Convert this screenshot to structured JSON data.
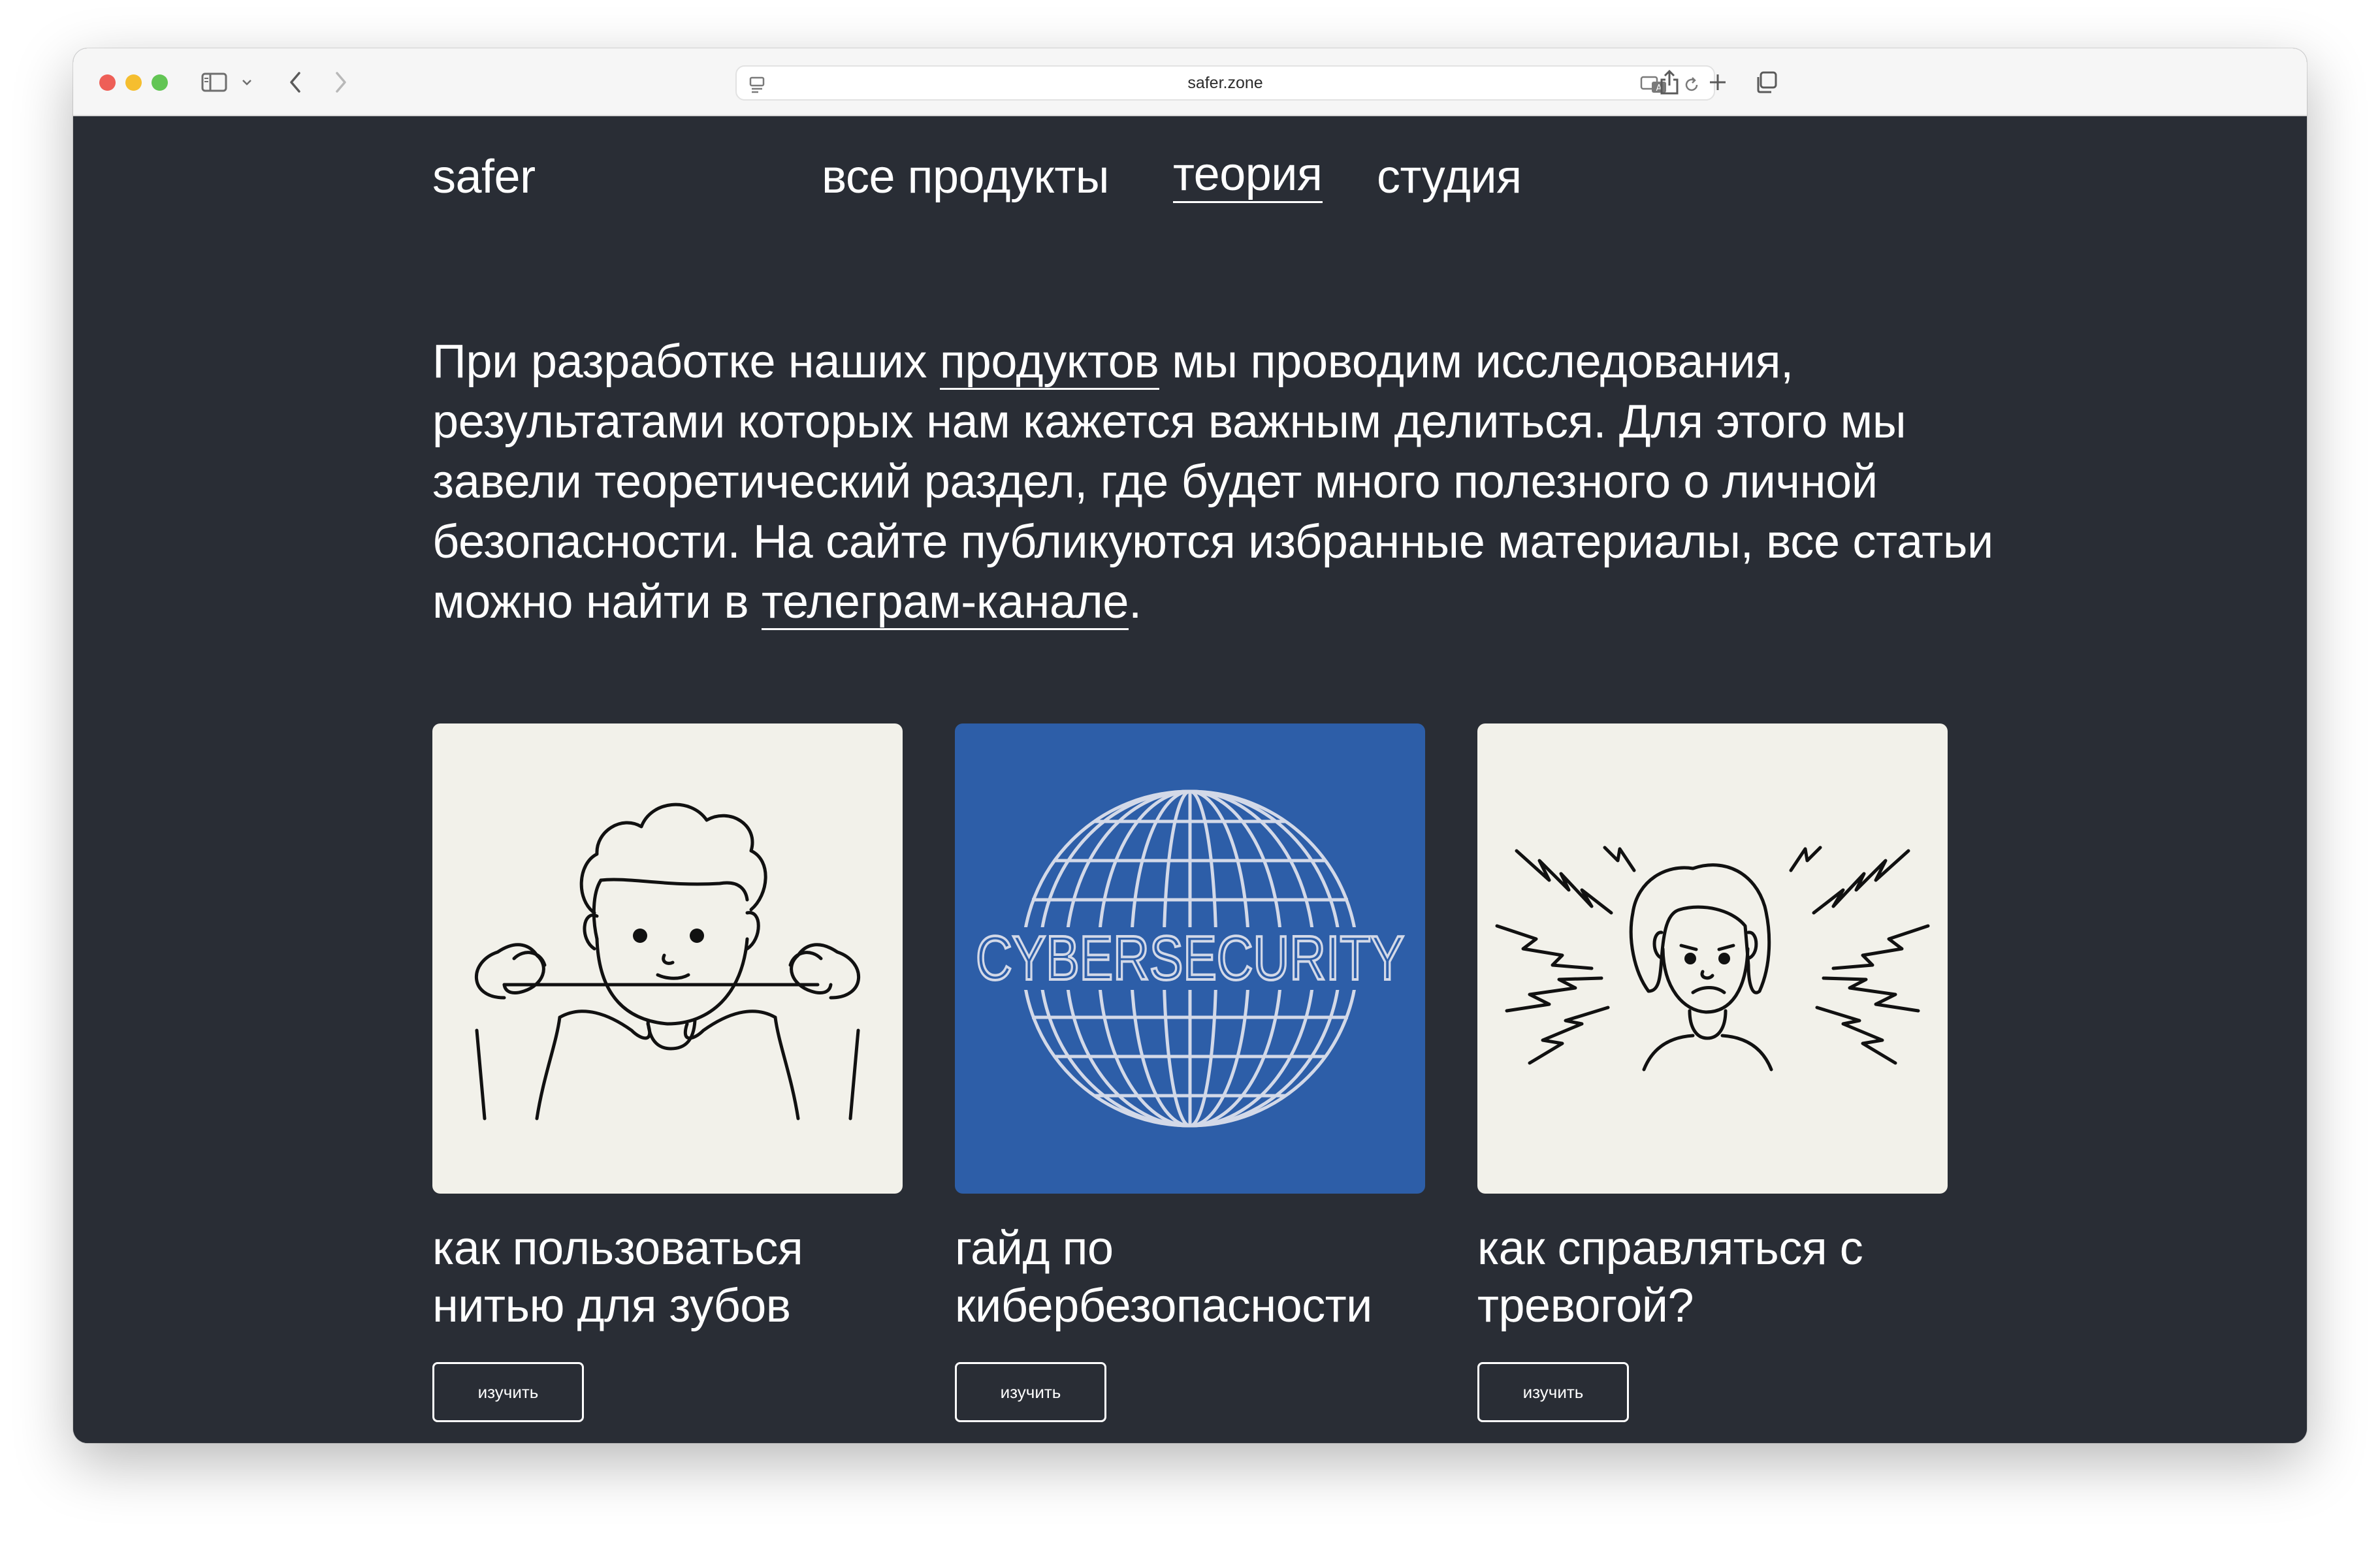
{
  "browser": {
    "url": "safer.zone"
  },
  "site": {
    "logo": "safer",
    "nav": [
      {
        "label": "все продукты",
        "active": false
      },
      {
        "label": "теория",
        "active": true
      },
      {
        "label": "студия",
        "active": false
      }
    ]
  },
  "intro": {
    "part1": "При разработке наших ",
    "link1": "продуктов",
    "part2": " мы проводим исследования, результатами которых нам кажется важным делиться. Для этого мы завели теоретический раздел, где будет много полезного о личной безопасности. На сайте публикуются избранные материалы, все статьи можно найти в ",
    "link2": "телеграм-канале",
    "part3": "."
  },
  "cards": [
    {
      "title": "как пользоваться\nнитью для зубов",
      "button": "изучить",
      "bg": "#f2f1ea",
      "illustration": "dental-floss-person"
    },
    {
      "title": "гайд по\nкибербезопасности",
      "button": "изучить",
      "bg": "#2d5ea8",
      "illustration": "cybersecurity-globe",
      "image_text": "CYBERSECURITY"
    },
    {
      "title": "как справляться с\nтревогой?",
      "button": "изучить",
      "bg": "#f2f1ea",
      "illustration": "anxious-person"
    }
  ],
  "colors": {
    "page_bg": "#292d35",
    "text": "#ffffff",
    "card_light": "#f2f1ea",
    "card_blue": "#2d5ea8"
  }
}
